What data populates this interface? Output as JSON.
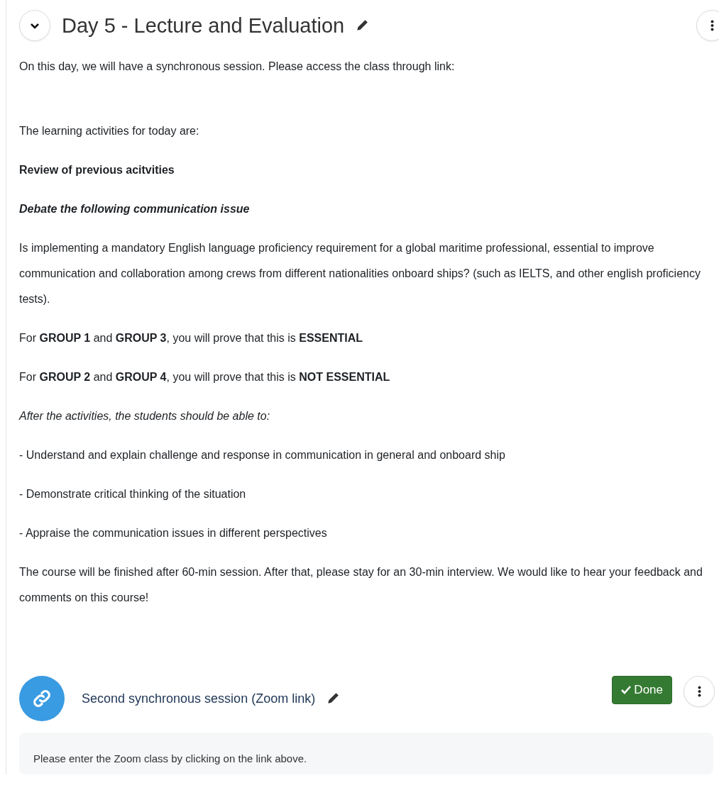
{
  "section": {
    "title": "Day 5 - Lecture and Evaluation",
    "expanded": true
  },
  "paragraphs": [
    {
      "kind": "plain",
      "text": "On this day, we will have a synchronous session. Please access the class through link:"
    },
    {
      "kind": "plain",
      "text": "The learning activities for today are:"
    },
    {
      "kind": "bold",
      "text": "Review of previous acitvities"
    },
    {
      "kind": "bold-italic",
      "text": "Debate the following communication issue"
    },
    {
      "kind": "plain",
      "text": "Is implementing a mandatory English language proficiency requirement for a global maritime professional, essential to improve communication and collaboration among crews from different nationalities onboard ships? (such as IELTS, and other english proficiency tests)."
    },
    {
      "kind": "plain",
      "text": "For **GROUP 1** and **GROUP 3**, you will prove that this is **ESSENTIAL**"
    },
    {
      "kind": "plain",
      "text": "For **GROUP 2** and **GROUP 4**, you will prove that this is **NOT ESSENTIAL**"
    },
    {
      "kind": "italic",
      "text": "After the activities, the students should be able to:"
    },
    {
      "kind": "plain",
      "text": "- Understand and explain challenge and response in communication in general and onboard ship"
    },
    {
      "kind": "plain",
      "text": "- Demonstrate critical thinking of the situation"
    },
    {
      "kind": "plain",
      "text": "- Appraise the communication issues in different perspectives"
    },
    {
      "kind": "plain",
      "text": "The course will be finished after 60-min session. After that, please stay for an 30-min interview. We would like to hear your feedback and comments on this course!"
    }
  ],
  "activity": {
    "name": "Second synchronous session (Zoom link)",
    "done": true,
    "done_label": "Done",
    "description": "Please enter the Zoom class by clicking on the link above."
  }
}
